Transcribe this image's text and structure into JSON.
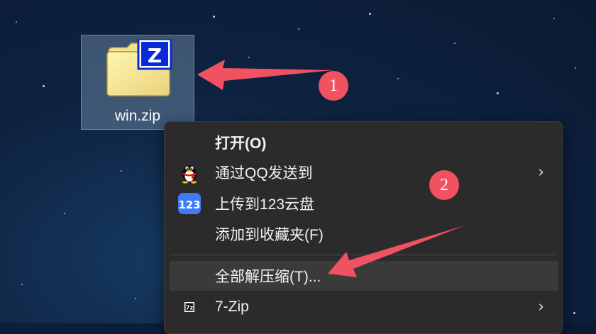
{
  "desktop": {
    "file": {
      "name": "win.zip",
      "icon": "zip-archive-icon"
    }
  },
  "annotations": {
    "badge1": "1",
    "badge2": "2",
    "arrow_color": "#f05262"
  },
  "context_menu": {
    "items": [
      {
        "label": "打开(O)",
        "icon": "none",
        "submenu": false,
        "bold": true
      },
      {
        "label": "通过QQ发送到",
        "icon": "qq-penguin-icon",
        "submenu": true
      },
      {
        "label": "上传到123云盘",
        "icon": "123-cloud-icon",
        "submenu": false,
        "icon_text": "123"
      },
      {
        "label": "添加到收藏夹(F)",
        "icon": "none",
        "submenu": false
      },
      {
        "label": "全部解压缩(T)...",
        "icon": "none",
        "submenu": false,
        "highlighted": true
      },
      {
        "label": "7-Zip",
        "icon": "7zip-icon",
        "submenu": true,
        "icon_text": "7z"
      }
    ]
  }
}
